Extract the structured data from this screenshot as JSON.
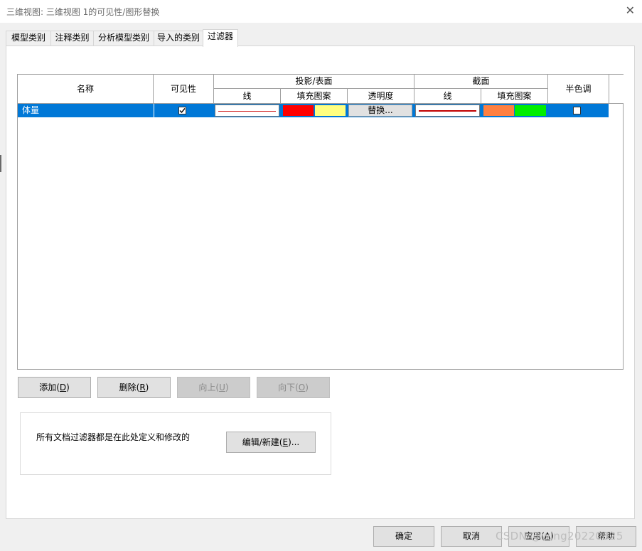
{
  "window": {
    "title": "三维视图: 三维视图 1的可见性/图形替换"
  },
  "tabs": [
    {
      "label": "模型类别",
      "active": false
    },
    {
      "label": "注释类别",
      "active": false
    },
    {
      "label": "分析模型类别",
      "active": false
    },
    {
      "label": "导入的类别",
      "active": false
    },
    {
      "label": "过滤器",
      "active": true
    }
  ],
  "table": {
    "headers": {
      "name": "名称",
      "visibility": "可见性",
      "projection_group": "投影/表面",
      "projection_line": "线",
      "projection_pattern": "填充图案",
      "transparency": "透明度",
      "cut_group": "截面",
      "cut_line": "线",
      "cut_pattern": "填充图案",
      "halftone": "半色调"
    },
    "rows": [
      {
        "name": "体量",
        "visible": true,
        "projection_line_color": "#d01818",
        "projection_pattern_colors": [
          "#ff0000",
          "#ffff80"
        ],
        "transparency_button": "替换...",
        "cut_line_color": "#c00000",
        "cut_pattern_colors": [
          "#ff8040",
          "#00ee00"
        ],
        "halftone": false
      }
    ],
    "selected_row_color": "#0078d7"
  },
  "buttons": {
    "add": {
      "label": "添加(",
      "key": "D",
      "end": ")"
    },
    "delete": {
      "label": "删除(",
      "key": "R",
      "end": ")"
    },
    "up": {
      "label": "向上(",
      "key": "U",
      "end": ")"
    },
    "down": {
      "label": "向下(",
      "key": "O",
      "end": ")"
    }
  },
  "info_group": {
    "text": "所有文档过滤器都是在此处定义和修改的",
    "edit_button": {
      "label": "编辑/新建(",
      "key": "E",
      "end": ")..."
    }
  },
  "footer": {
    "ok": "确定",
    "cancel": "取消",
    "apply": {
      "label": "应用(",
      "key": "A",
      "end": ")"
    },
    "help": "帮助"
  },
  "watermark": "CSDN @wing20220825"
}
